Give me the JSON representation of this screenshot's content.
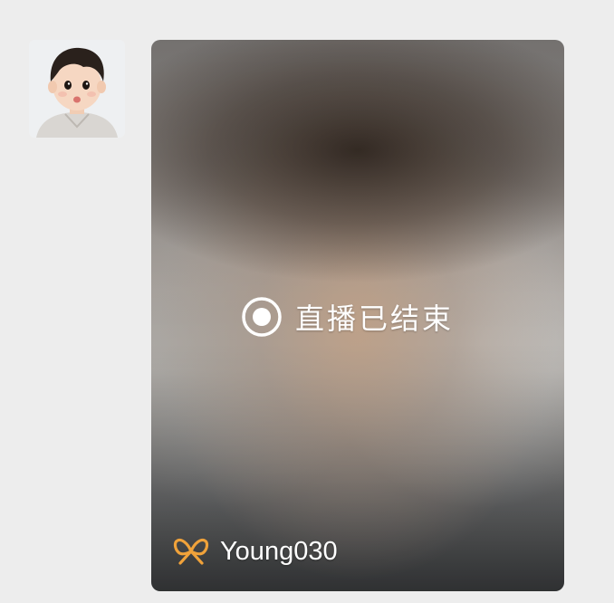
{
  "message": {
    "live_card": {
      "status_text": "直播已结束",
      "channel_name": "Young030",
      "channel_icon": "channels-butterfly-icon",
      "status_icon": "live-ended-record-icon",
      "accent_color": "#f0a23a"
    },
    "sender_avatar": "child-avatar-photo"
  }
}
